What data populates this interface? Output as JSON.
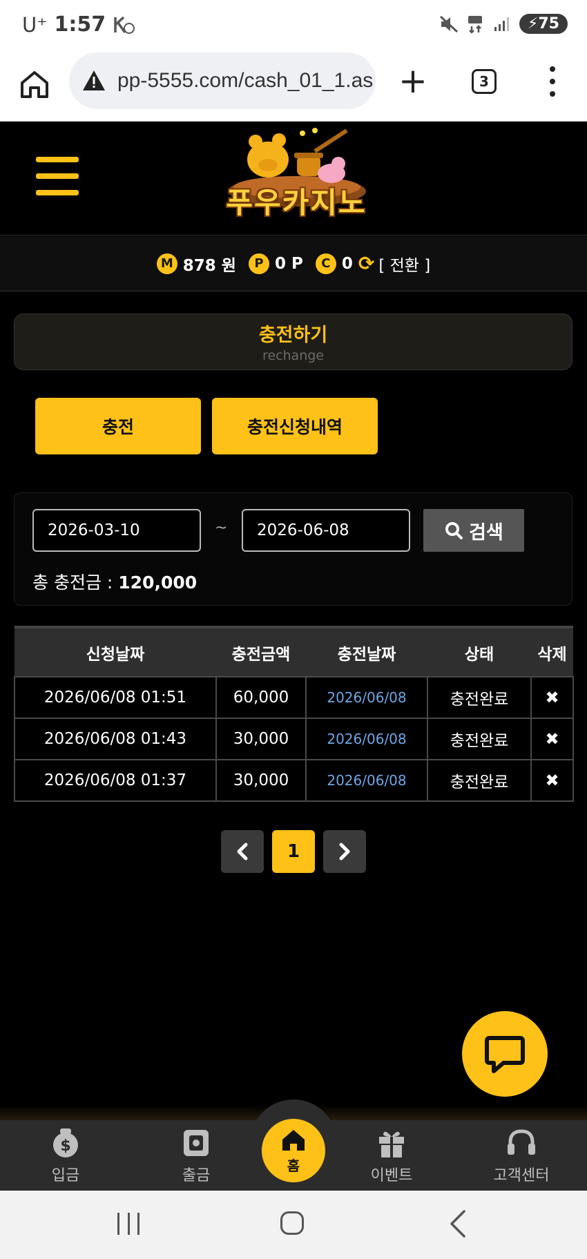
{
  "status_bar": {
    "carrier": "U⁺",
    "time": "1:57",
    "battery": "75"
  },
  "browser": {
    "url": "pp-5555.com/cash_01_1.as",
    "tab_count": "3"
  },
  "site": {
    "logo_text": "푸우카지노"
  },
  "balance": {
    "money_icon": "M",
    "money": "878 원",
    "point_icon": "P",
    "point": "0 P",
    "coupon_icon": "C",
    "coupon": "0",
    "switch_label": "[ 전환 ]"
  },
  "title_card": {
    "title": "충전하기",
    "subtitle": "rechange"
  },
  "tabs": {
    "charge": "충전",
    "history": "충전신청내역"
  },
  "search": {
    "date_from": "2026-03-10",
    "separator": "~",
    "date_to": "2026-06-08",
    "button_label": "검색",
    "total_label": "총 충전금 : ",
    "total_value": "120,000"
  },
  "table": {
    "headers": [
      "신청날짜",
      "충전금액",
      "충전날짜",
      "상태",
      "삭제"
    ],
    "rows": [
      {
        "request_date": "2026/06/08 01:51",
        "amount": "60,000",
        "charge_date": "2026/06/08",
        "status": "충전완료",
        "delete": "✖"
      },
      {
        "request_date": "2026/06/08 01:43",
        "amount": "30,000",
        "charge_date": "2026/06/08",
        "status": "충전완료",
        "delete": "✖"
      },
      {
        "request_date": "2026/06/08 01:37",
        "amount": "30,000",
        "charge_date": "2026/06/08",
        "status": "충전완료",
        "delete": "✖"
      }
    ]
  },
  "pagination": {
    "current": "1"
  },
  "bottom_nav": {
    "deposit": "입금",
    "withdraw": "출금",
    "home": "홈",
    "event": "이벤트",
    "support": "고객센터"
  },
  "colors": {
    "accent": "#fdc118",
    "background": "#000000",
    "link_date": "#6ea7e6"
  },
  "icons": [
    "home-icon",
    "warning-icon",
    "plus-icon",
    "tabs-icon",
    "more-icon",
    "menu-icon",
    "refresh-icon",
    "search-icon",
    "close-icon",
    "chevron-left-icon",
    "chevron-right-icon",
    "chat-icon",
    "dollar-bag-icon",
    "safe-icon",
    "gift-icon",
    "headset-icon"
  ]
}
